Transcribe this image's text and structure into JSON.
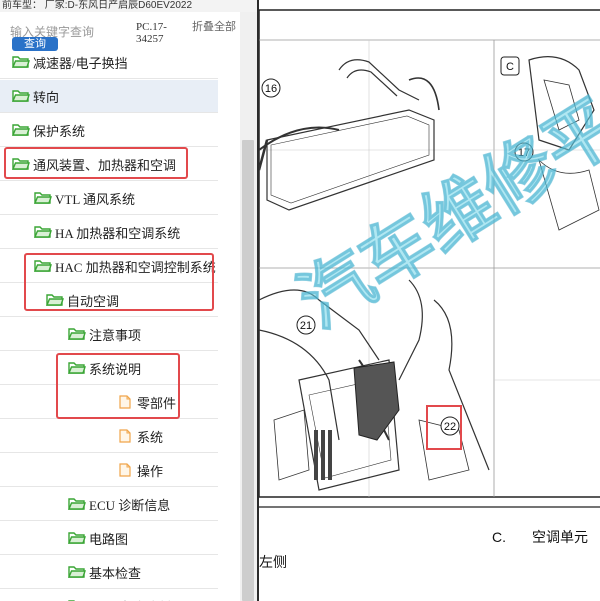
{
  "window": {
    "caption": "前车型：   厂家:D-东风日产启辰D60EV2022"
  },
  "search": {
    "placeholder": "输入关键字查询",
    "button_label": "查询",
    "pc_code": "PC.17-34257",
    "collapse_all": "折叠全部"
  },
  "tree": {
    "items": [
      {
        "label": "减速器/电子换挡",
        "icon": "folder-open-icon"
      },
      {
        "label": "转向",
        "icon": "folder-open-icon",
        "selected": true
      },
      {
        "label": "保护系统",
        "icon": "folder-open-icon"
      },
      {
        "label": "通风装置、加热器和空调",
        "icon": "folder-open-icon",
        "highlighted": true
      },
      {
        "label": "VTL 通风系统",
        "icon": "folder-open-icon"
      },
      {
        "label": "HA 加热器和空调系统",
        "icon": "folder-open-icon"
      },
      {
        "label": "HAC 加热器和空调控制系统",
        "icon": "folder-open-icon",
        "highlighted": true
      },
      {
        "label": "自动空调",
        "icon": "folder-open-icon",
        "highlighted": true
      },
      {
        "label": "注意事项",
        "icon": "folder-open-icon"
      },
      {
        "label": "系统说明",
        "icon": "folder-open-icon",
        "highlighted": true
      },
      {
        "label": "零部件",
        "icon": "document-icon",
        "highlighted": true
      },
      {
        "label": "系统",
        "icon": "document-icon"
      },
      {
        "label": "操作",
        "icon": "document-icon"
      },
      {
        "label": "ECU 诊断信息",
        "icon": "folder-open-icon"
      },
      {
        "label": "电路图",
        "icon": "folder-open-icon"
      },
      {
        "label": "基本检查",
        "icon": "folder-open-icon"
      },
      {
        "label": "DTC/电路诊断",
        "icon": "folder-open-icon"
      }
    ]
  },
  "document": {
    "callouts": [
      "16",
      "17",
      "21",
      "22"
    ],
    "section_marker": "C",
    "caption_letter": "C.",
    "caption_text": "空调单元",
    "side_label": "左侧",
    "watermark": "汽车维修平台"
  },
  "colors": {
    "highlight_red": "#e2494c",
    "button_blue": "#2a72c8",
    "folder_green": "#3aa535",
    "document_orange": "#f0a54a",
    "watermark_cyan": "#6fd3e8",
    "selected_row": "#e8eef6"
  }
}
